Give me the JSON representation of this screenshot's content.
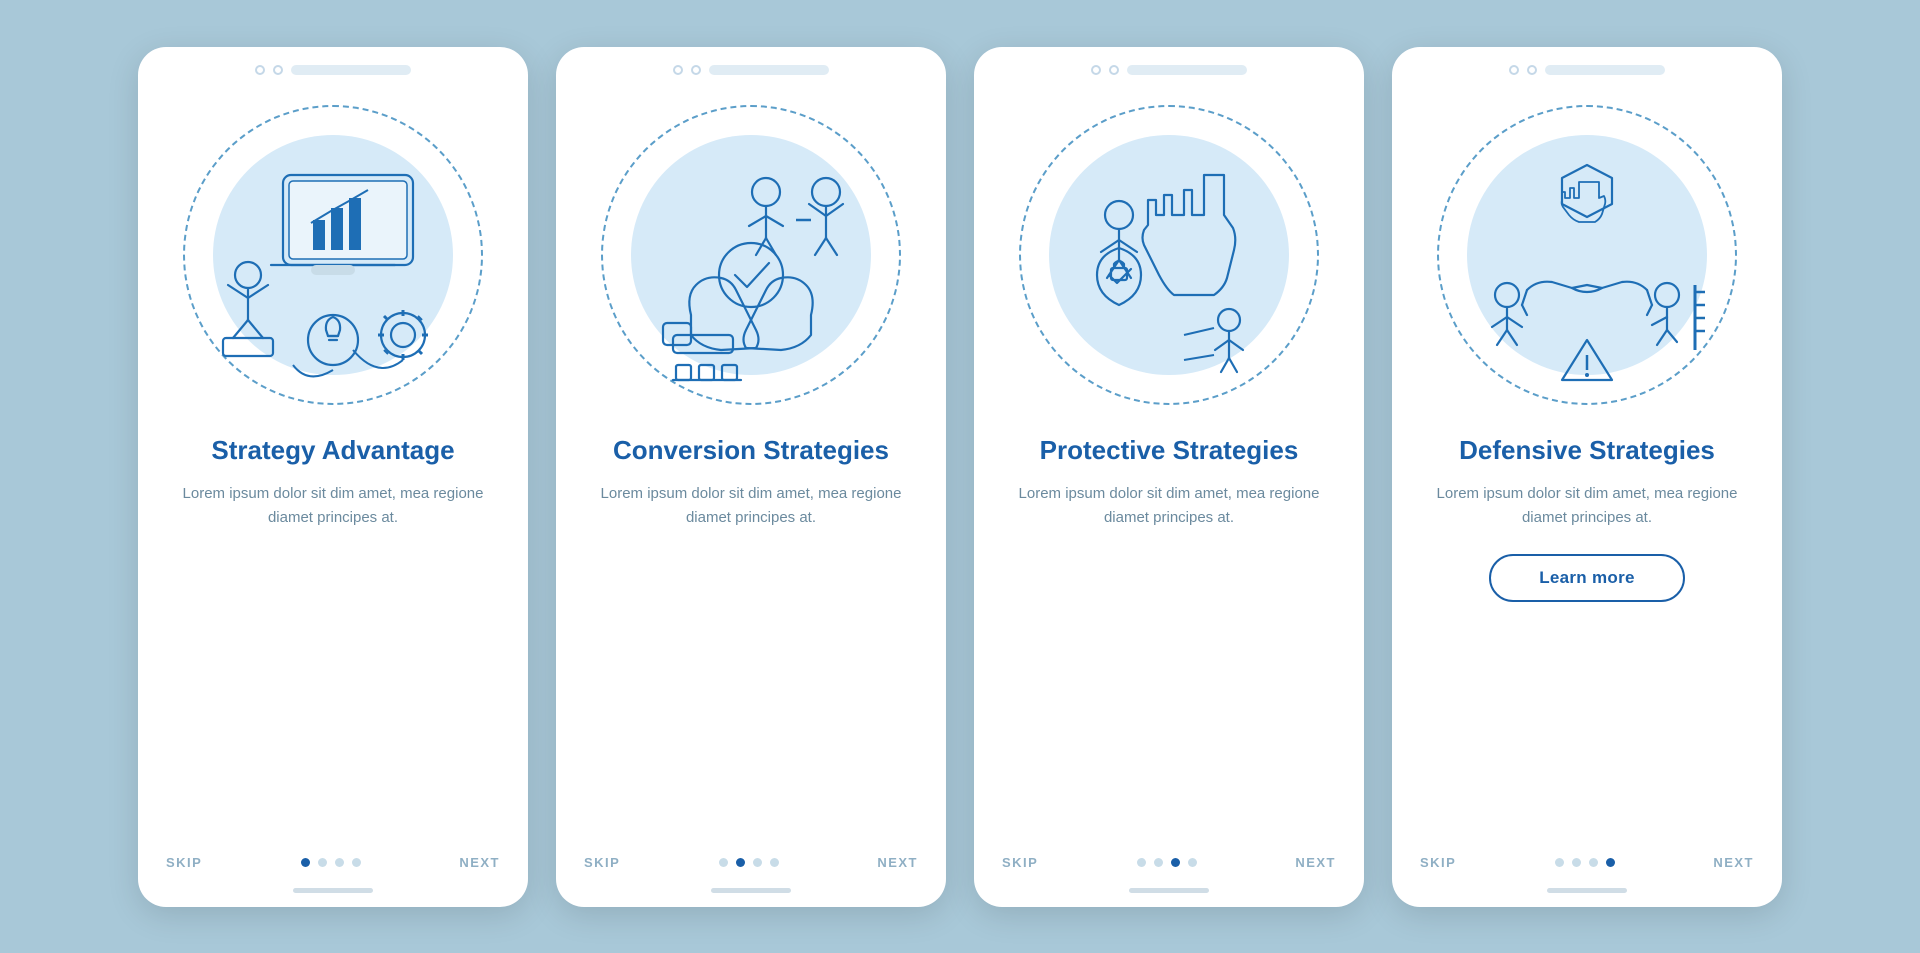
{
  "background": "#a8c8d8",
  "cards": [
    {
      "id": "strategy-advantage",
      "title": "Strategy\nAdvantage",
      "body": "Lorem ipsum dolor sit dim amet, mea regione diamet principes at.",
      "show_learn_more": false,
      "nav": {
        "skip": "SKIP",
        "next": "NEXT",
        "dots": [
          true,
          false,
          false,
          false
        ]
      }
    },
    {
      "id": "conversion-strategies",
      "title": "Conversion\nStrategies",
      "body": "Lorem ipsum dolor sit dim amet, mea regione diamet principes at.",
      "show_learn_more": false,
      "nav": {
        "skip": "SKIP",
        "next": "NEXT",
        "dots": [
          false,
          true,
          false,
          false
        ]
      }
    },
    {
      "id": "protective-strategies",
      "title": "Protective\nStrategies",
      "body": "Lorem ipsum dolor sit dim amet, mea regione diamet principes at.",
      "show_learn_more": false,
      "nav": {
        "skip": "SKIP",
        "next": "NEXT",
        "dots": [
          false,
          false,
          true,
          false
        ]
      }
    },
    {
      "id": "defensive-strategies",
      "title": "Defensive\nStrategies",
      "body": "Lorem ipsum dolor sit dim amet, mea regione diamet principes at.",
      "show_learn_more": true,
      "learn_more_label": "Learn more",
      "nav": {
        "skip": "SKIP",
        "next": "NEXT",
        "dots": [
          false,
          false,
          false,
          true
        ]
      }
    }
  ]
}
